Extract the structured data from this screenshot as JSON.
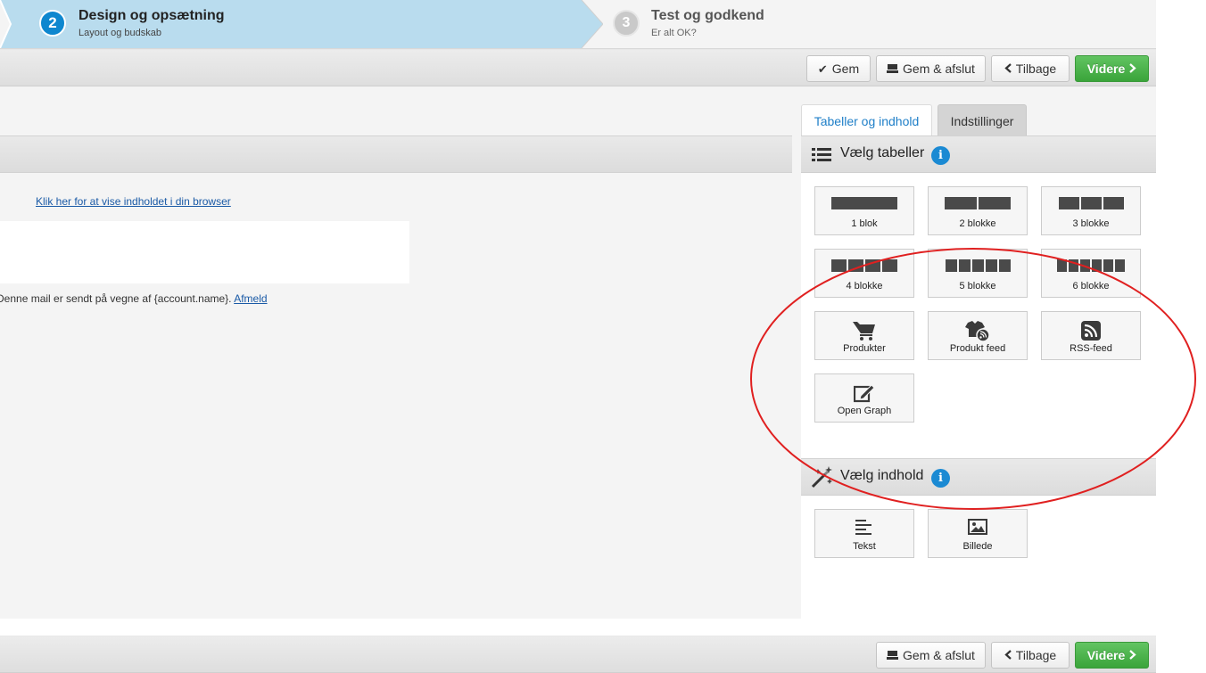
{
  "wizard": {
    "steps": [
      {
        "number": "2",
        "title": "Design og opsætning",
        "subtitle": "Layout og budskab"
      },
      {
        "number": "3",
        "title": "Test og godkend",
        "subtitle": "Er alt OK?"
      }
    ]
  },
  "toolbar_top": {
    "save": "Gem",
    "save_close": "Gem & afslut",
    "back": "Tilbage",
    "next": "Videre"
  },
  "toolbar_bottom": {
    "save_close": "Gem & afslut",
    "back": "Tilbage",
    "next": "Videre"
  },
  "editor": {
    "browser_link": "Klik her for at vise indholdet i din browser",
    "footer_text": "Denne mail er sendt på vegne af {account.name}.",
    "unsubscribe_link": "Afmeld"
  },
  "panel": {
    "tabs": [
      {
        "label": "Tabeller og indhold",
        "active": true
      },
      {
        "label": "Indstillinger",
        "active": false
      }
    ],
    "tables_section": {
      "title": "Vælg tabeller",
      "info": "i",
      "tiles": [
        {
          "label": "1 blok",
          "blocks": 1
        },
        {
          "label": "2 blokke",
          "blocks": 2
        },
        {
          "label": "3 blokke",
          "blocks": 3
        },
        {
          "label": "4 blokke",
          "blocks": 4
        },
        {
          "label": "5 blokke",
          "blocks": 5
        },
        {
          "label": "6 blokke",
          "blocks": 6
        },
        {
          "label": "Produkter",
          "icon": "cart-icon"
        },
        {
          "label": "Produkt feed",
          "icon": "tshirt-rss-icon"
        },
        {
          "label": "RSS-feed",
          "icon": "rss-icon"
        },
        {
          "label": "Open Graph",
          "icon": "edit-icon"
        }
      ]
    },
    "content_section": {
      "title": "Vælg indhold",
      "info": "i",
      "tiles": [
        {
          "label": "Tekst",
          "icon": "text-lines-icon"
        },
        {
          "label": "Billede",
          "icon": "image-icon"
        }
      ]
    }
  },
  "colors": {
    "active_step": "#b9dcee",
    "accent_blue": "#1b8ad3",
    "green_button": "#4cb34c",
    "annotation_red": "#e02020"
  }
}
